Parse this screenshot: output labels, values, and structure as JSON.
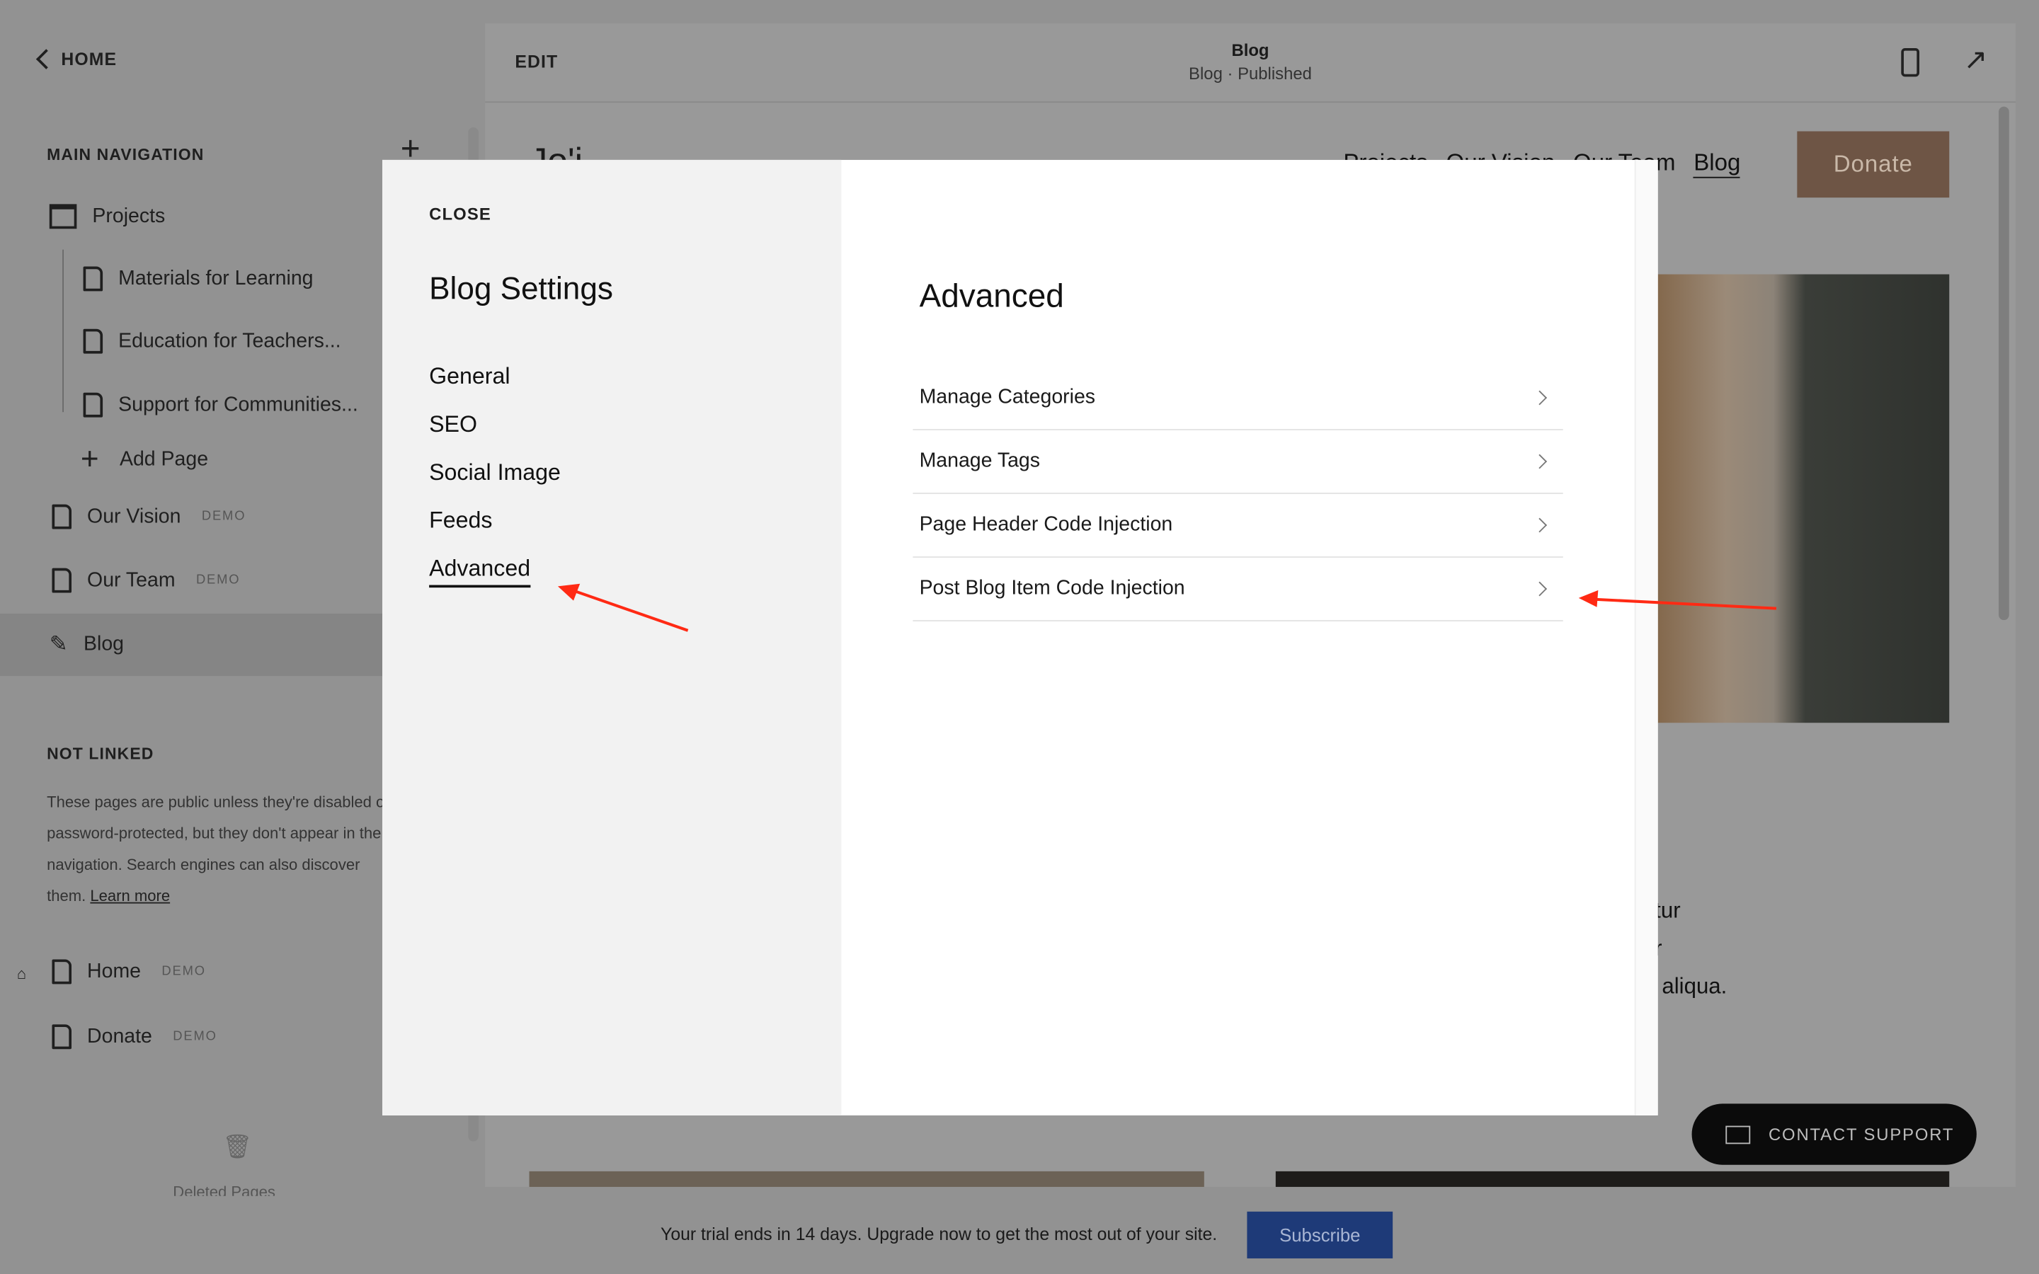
{
  "sidebar": {
    "home_label": "HOME",
    "main_nav_title": "MAIN NAVIGATION",
    "items": [
      {
        "label": "Projects",
        "icon": "folder-icon"
      },
      {
        "label": "Materials for Learning",
        "icon": "page-icon"
      },
      {
        "label": "Education for Teachers...",
        "icon": "page-icon"
      },
      {
        "label": "Support for Communities...",
        "icon": "page-icon"
      },
      {
        "label": "Add Page",
        "icon": "plus-icon"
      },
      {
        "label": "Our Vision",
        "badge": "DEMO",
        "icon": "page-icon"
      },
      {
        "label": "Our Team",
        "badge": "DEMO",
        "icon": "page-icon"
      },
      {
        "label": "Blog",
        "icon": "blog-icon",
        "selected": true
      }
    ],
    "not_linked_title": "NOT LINKED",
    "not_linked_text": "These pages are public unless they're disabled or password-protected, but they don't appear in the navigation. Search engines can also discover them.",
    "learn_more": "Learn more",
    "not_linked_items": [
      {
        "label": "Home",
        "badge": "DEMO"
      },
      {
        "label": "Donate",
        "badge": "DEMO"
      }
    ],
    "deleted_pages": "Deleted Pages"
  },
  "topbar": {
    "edit_label": "EDIT",
    "title": "Blog",
    "subtitle": "Blog · Published"
  },
  "preview": {
    "logo": "Jo'i",
    "nav": [
      "Projects",
      "Our Vision",
      "Our Team",
      "Blog"
    ],
    "donate": "Donate",
    "text_lines": [
      "etur",
      "or",
      "aliqua."
    ]
  },
  "modal": {
    "close": "CLOSE",
    "title": "Blog Settings",
    "menu": [
      "General",
      "SEO",
      "Social Image",
      "Feeds",
      "Advanced"
    ],
    "active": "Advanced",
    "panel_title": "Advanced",
    "rows": [
      "Manage Categories",
      "Manage Tags",
      "Page Header Code Injection",
      "Post Blog Item Code Injection"
    ]
  },
  "annotation_color": "#ff2a14",
  "contact_support": "CONTACT SUPPORT",
  "trial": {
    "text": "Your trial ends in 14 days. Upgrade now to get the most out of your site.",
    "subscribe": "Subscribe",
    "subscribe_color": "#1e3a78"
  }
}
